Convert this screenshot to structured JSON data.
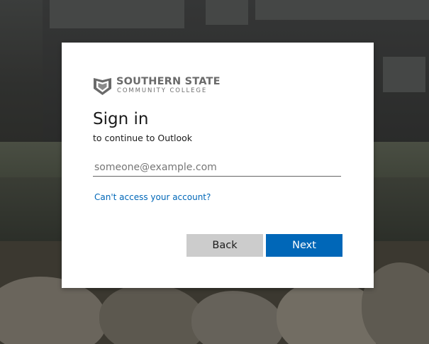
{
  "logo": {
    "line1": "SOUTHERN STATE",
    "line2": "COMMUNITY COLLEGE"
  },
  "signin": {
    "title": "Sign in",
    "subtitle": "to continue to Outlook",
    "email_placeholder": "someone@example.com",
    "email_value": "",
    "cant_access_link": "Can't access your account?"
  },
  "buttons": {
    "back_label": "Back",
    "next_label": "Next"
  },
  "colors": {
    "accent": "#0067b8",
    "back_button": "#cccccc",
    "logo_gray": "#6a6a6a"
  }
}
